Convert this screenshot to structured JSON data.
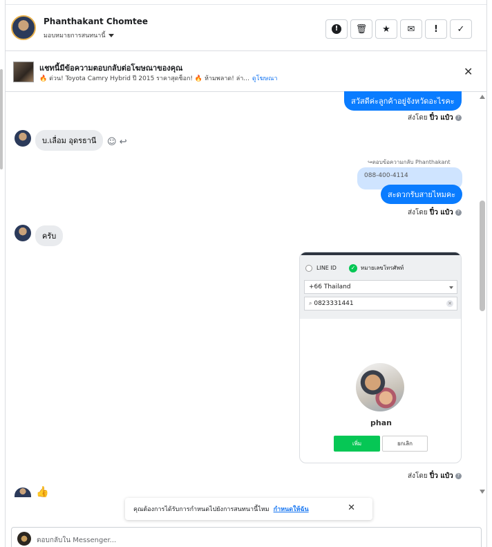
{
  "header": {
    "name": "Phanthakant Chomtee",
    "assign_label": "มอบหมายการสนทนานี้",
    "buttons": [
      {
        "icon": "!",
        "name": "alert-circle-icon"
      },
      {
        "icon": "🗑",
        "name": "trash-icon"
      },
      {
        "icon": "★",
        "name": "star-icon"
      },
      {
        "icon": "✉",
        "name": "mail-icon"
      },
      {
        "icon": "!",
        "name": "exclamation-icon"
      },
      {
        "icon": "✓",
        "name": "check-icon"
      }
    ]
  },
  "ad": {
    "title": "แชทนี้มีข้อความตอบกลับต่อโฆษณาของคุณ",
    "subtitle": "🔥 ด่วน! Toyota Camry Hybrid ปี 2015 ราคาสุดช็อก! 🔥 ห้ามพลาด! ล่า...",
    "link": "ดูโฆษณา",
    "close": "✕"
  },
  "messages": {
    "out1": "สวัสดีค่ะลูกค้าอยู่จังหวัดอะไรคะ",
    "sent_prefix": "ส่งโดย",
    "sent_by": "ปิ๋ว แป๋ว",
    "in1": "บ.เลื่อม อุดรธานี",
    "reply_note": "↪ตอบข้อความกลับ Phanthakant",
    "quoted": "088-400-4114",
    "out2": "สะดวกรับสายไหมคะ",
    "in2": "ครับ",
    "thumb": "👍"
  },
  "card": {
    "radio_line": "LINE ID",
    "radio_phone": "หมายเลขโทรศัพท์",
    "country": "+66  Thailand",
    "phone": "0823331441",
    "profile_name": "phan",
    "add": "เพิ่ม",
    "cancel": "ยกเลิก"
  },
  "toast": {
    "text": "คุณต้องการได้รับการกำหนดไปยังการสนทนานี้ไหม",
    "link": "กำหนดให้ฉัน",
    "close": "✕"
  },
  "composer": {
    "placeholder": "ตอบกลับใน Messenger..."
  }
}
